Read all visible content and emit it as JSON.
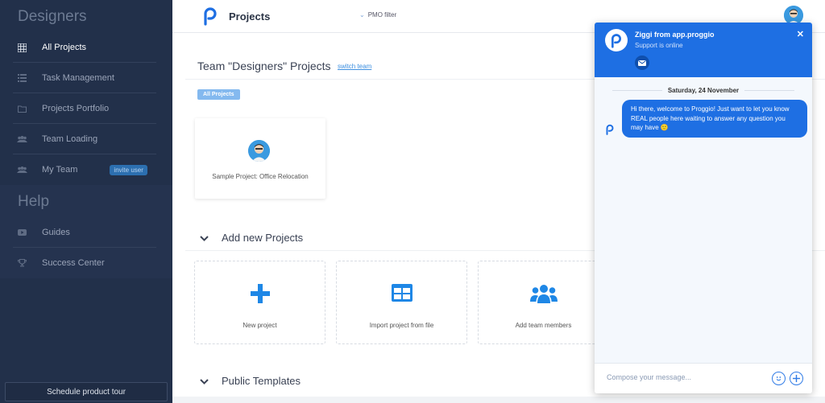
{
  "sidebar": {
    "heading": "Designers",
    "items": [
      {
        "label": "All Projects",
        "icon": "grid-icon",
        "active": true
      },
      {
        "label": "Task Management",
        "icon": "list-icon"
      },
      {
        "label": "Projects Portfolio",
        "icon": "folder-icon"
      },
      {
        "label": "Team Loading",
        "icon": "team-icon"
      },
      {
        "label": "My Team",
        "icon": "team-icon",
        "badge": "invite user"
      }
    ],
    "help_heading": "Help",
    "help_items": [
      {
        "label": "Guides",
        "icon": "youtube-icon"
      },
      {
        "label": "Success Center",
        "icon": "trophy-icon"
      }
    ],
    "tour_button": "Schedule product tour"
  },
  "topbar": {
    "title": "Projects",
    "pmo_filter": "PMO filter"
  },
  "main": {
    "team_title": "Team \"Designers\" Projects",
    "switch_team": "switch team",
    "filter_pill": "All Projects",
    "project_card": "Sample Project: Office Relocation",
    "add_section": "Add new Projects",
    "add_cards": [
      {
        "label": "New project",
        "icon": "plus-icon"
      },
      {
        "label": "Import project from file",
        "icon": "table-icon"
      },
      {
        "label": "Add team members",
        "icon": "users-icon"
      }
    ],
    "templates_section": "Public Templates"
  },
  "chat": {
    "name": "Ziggi from app.proggio",
    "status": "Support is online",
    "date": "Saturday, 24 November",
    "message": "Hi there, welcome to Proggio! Just want to let you know REAL people here waiting to answer any question you may have 🙂",
    "compose_placeholder": "Compose your message...",
    "accent": "#1e6fe3"
  }
}
